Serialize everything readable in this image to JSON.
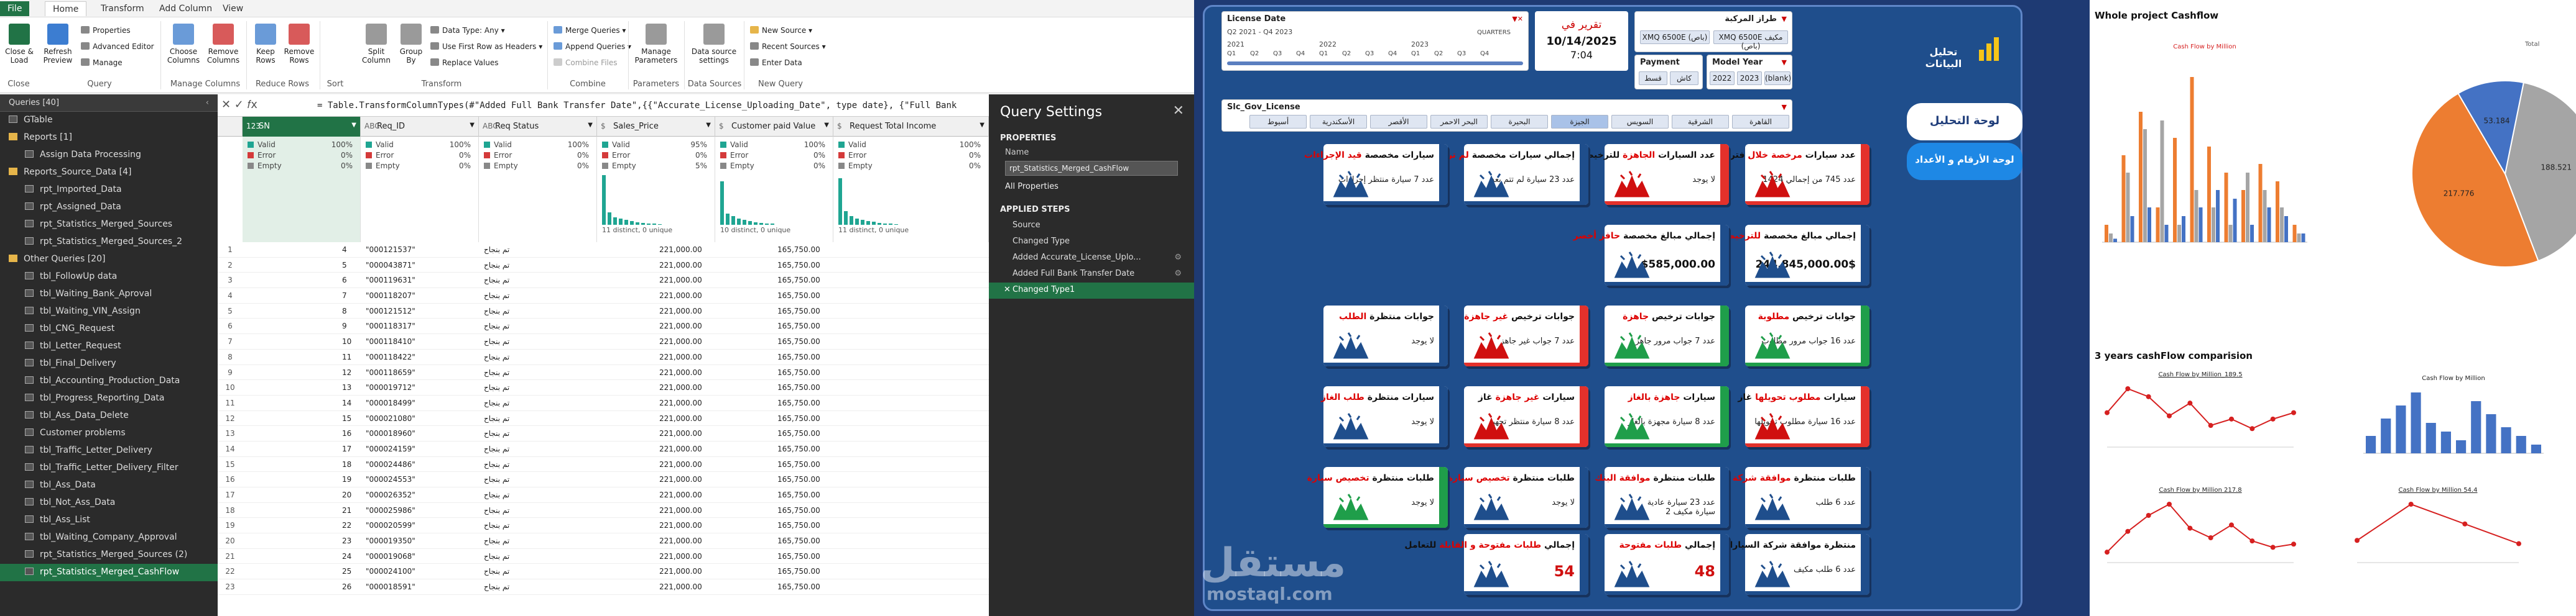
{
  "pq": {
    "tabs": [
      "File",
      "Home",
      "Transform",
      "Add Column",
      "View"
    ],
    "ribbon": {
      "close_load": "Close &\nLoad",
      "refresh": "Refresh\nPreview",
      "properties": "Properties",
      "advanced_editor": "Advanced Editor",
      "manage": "Manage",
      "choose_columns": "Choose\nColumns",
      "remove_columns": "Remove\nColumns",
      "keep_rows": "Keep\nRows",
      "remove_rows": "Remove\nRows",
      "split_column": "Split\nColumn",
      "group_by": "Group\nBy",
      "data_type": "Data Type: Any",
      "use_first_row": "Use First Row as Headers",
      "replace_values": "Replace Values",
      "merge_queries": "Merge Queries",
      "append_queries": "Append Queries",
      "combine_files": "Combine Files",
      "manage_parameters": "Manage\nParameters",
      "data_source_settings": "Data source\nsettings",
      "new_source": "New Source",
      "recent_sources": "Recent Sources",
      "enter_data": "Enter Data",
      "groups": [
        "Close",
        "Query",
        "Manage Columns",
        "Reduce Rows",
        "Sort",
        "Transform",
        "Combine",
        "Parameters",
        "Data Sources",
        "New Query"
      ]
    },
    "queries_header": "Queries [40]",
    "queries": [
      {
        "label": "GTable",
        "kind": "table",
        "indent": 0
      },
      {
        "label": "Reports [1]",
        "kind": "folder",
        "indent": 0
      },
      {
        "label": "Assign Data Processing",
        "kind": "table",
        "indent": 1
      },
      {
        "label": "Reports_Source_Data [4]",
        "kind": "folder",
        "indent": 0
      },
      {
        "label": "rpt_Imported_Data",
        "kind": "table",
        "indent": 1
      },
      {
        "label": "rpt_Assigned_Data",
        "kind": "table",
        "indent": 1
      },
      {
        "label": "rpt_Statistics_Merged_Sources",
        "kind": "table",
        "indent": 1
      },
      {
        "label": "rpt_Statistics_Merged_Sources_2",
        "kind": "table",
        "indent": 1
      },
      {
        "label": "Other Queries [20]",
        "kind": "folder",
        "indent": 0
      },
      {
        "label": "tbl_FollowUp data",
        "kind": "table",
        "indent": 1
      },
      {
        "label": "tbl_Waiting_Bank_Aproval",
        "kind": "table",
        "indent": 1
      },
      {
        "label": "tbl_Waiting_VIN_Assign",
        "kind": "table",
        "indent": 1
      },
      {
        "label": "tbl_CNG_Request",
        "kind": "table",
        "indent": 1
      },
      {
        "label": "tbl_Letter_Request",
        "kind": "table",
        "indent": 1
      },
      {
        "label": "tbl_Final_Delivery",
        "kind": "table",
        "indent": 1
      },
      {
        "label": "tbl_Accounting_Production_Data",
        "kind": "table",
        "indent": 1
      },
      {
        "label": "tbl_Progress_Reporting_Data",
        "kind": "table",
        "indent": 1
      },
      {
        "label": "tbl_Ass_Data_Delete",
        "kind": "table",
        "indent": 1
      },
      {
        "label": "Customer problems",
        "kind": "table",
        "indent": 1
      },
      {
        "label": "tbl_Traffic_Letter_Delivery",
        "kind": "table",
        "indent": 1
      },
      {
        "label": "tbl_Traffic_Letter_Delivery_Filter",
        "kind": "table",
        "indent": 1
      },
      {
        "label": "tbl_Ass_Data",
        "kind": "table",
        "indent": 1
      },
      {
        "label": "tbl_Not_Ass_Data",
        "kind": "table",
        "indent": 1
      },
      {
        "label": "tbl_Ass_List",
        "kind": "table",
        "indent": 1
      },
      {
        "label": "tbl_Waiting_Company_Approval",
        "kind": "table",
        "indent": 1
      },
      {
        "label": "rpt_Statistics_Merged_Sources (2)",
        "kind": "table",
        "indent": 1
      },
      {
        "label": "rpt_Statistics_Merged_CashFlow",
        "kind": "table",
        "indent": 1,
        "selected": true
      }
    ],
    "formula": "= Table.TransformColumnTypes(#\"Added Full Bank Transfer Date\",{{\"Accurate_License_Uploading_Date\", type date}, {\"Full Bank",
    "columns": [
      {
        "label": "SN",
        "type": "123",
        "sel": true
      },
      {
        "label": "Req_ID",
        "type": "ABC"
      },
      {
        "label": "Req Status",
        "type": "ABC"
      },
      {
        "label": "Sales_Price",
        "type": "$"
      },
      {
        "label": "Customer paid Value",
        "type": "$"
      },
      {
        "label": "Request Total Income",
        "type": "$"
      }
    ],
    "profile": [
      {
        "valid": "100%",
        "error": "0%",
        "empty": "0%",
        "dist": ""
      },
      {
        "valid": "100%",
        "error": "0%",
        "empty": "0%",
        "dist": ""
      },
      {
        "valid": "100%",
        "error": "0%",
        "empty": "0%",
        "dist": ""
      },
      {
        "valid": "95%",
        "error": "0%",
        "empty": "5%",
        "dist": "11 distinct, 0 unique"
      },
      {
        "valid": "100%",
        "error": "0%",
        "empty": "0%",
        "dist": "10 distinct, 0 unique"
      },
      {
        "valid": "100%",
        "error": "0%",
        "empty": "0%",
        "dist": "11 distinct, 0 unique"
      }
    ],
    "profile_labels": {
      "valid": "Valid",
      "error": "Error",
      "empty": "Empty"
    },
    "rows": [
      {
        "n": "1",
        "sn": "4",
        "id": "\"000121537\"",
        "st": "تم بنجاح",
        "sp": "221,000.00",
        "cp": "165,750.00"
      },
      {
        "n": "2",
        "sn": "5",
        "id": "\"000043871\"",
        "st": "تم بنجاح",
        "sp": "221,000.00",
        "cp": "165,750.00"
      },
      {
        "n": "3",
        "sn": "6",
        "id": "\"000119631\"",
        "st": "تم بنجاح",
        "sp": "221,000.00",
        "cp": "165,750.00"
      },
      {
        "n": "4",
        "sn": "7",
        "id": "\"000118207\"",
        "st": "تم بنجاح",
        "sp": "221,000.00",
        "cp": "165,750.00"
      },
      {
        "n": "5",
        "sn": "8",
        "id": "\"000121512\"",
        "st": "تم بنجاح",
        "sp": "221,000.00",
        "cp": "165,750.00"
      },
      {
        "n": "6",
        "sn": "9",
        "id": "\"000118317\"",
        "st": "تم بنجاح",
        "sp": "221,000.00",
        "cp": "165,750.00"
      },
      {
        "n": "7",
        "sn": "10",
        "id": "\"000118410\"",
        "st": "تم بنجاح",
        "sp": "221,000.00",
        "cp": "165,750.00"
      },
      {
        "n": "8",
        "sn": "11",
        "id": "\"000118422\"",
        "st": "تم بنجاح",
        "sp": "221,000.00",
        "cp": "165,750.00"
      },
      {
        "n": "9",
        "sn": "12",
        "id": "\"000118659\"",
        "st": "تم بنجاح",
        "sp": "221,000.00",
        "cp": "165,750.00"
      },
      {
        "n": "10",
        "sn": "13",
        "id": "\"000019712\"",
        "st": "تم بنجاح",
        "sp": "221,000.00",
        "cp": "165,750.00"
      },
      {
        "n": "11",
        "sn": "14",
        "id": "\"000018499\"",
        "st": "تم بنجاح",
        "sp": "221,000.00",
        "cp": "165,750.00"
      },
      {
        "n": "12",
        "sn": "15",
        "id": "\"000021080\"",
        "st": "تم بنجاح",
        "sp": "221,000.00",
        "cp": "165,750.00"
      },
      {
        "n": "13",
        "sn": "16",
        "id": "\"000018960\"",
        "st": "تم بنجاح",
        "sp": "221,000.00",
        "cp": "165,750.00"
      },
      {
        "n": "14",
        "sn": "17",
        "id": "\"000024159\"",
        "st": "تم بنجاح",
        "sp": "221,000.00",
        "cp": "165,750.00"
      },
      {
        "n": "15",
        "sn": "18",
        "id": "\"000024486\"",
        "st": "تم بنجاح",
        "sp": "221,000.00",
        "cp": "165,750.00"
      },
      {
        "n": "16",
        "sn": "19",
        "id": "\"000024553\"",
        "st": "تم بنجاح",
        "sp": "221,000.00",
        "cp": "165,750.00"
      },
      {
        "n": "17",
        "sn": "20",
        "id": "\"000026352\"",
        "st": "تم بنجاح",
        "sp": "221,000.00",
        "cp": "165,750.00"
      },
      {
        "n": "18",
        "sn": "21",
        "id": "\"000025986\"",
        "st": "تم بنجاح",
        "sp": "221,000.00",
        "cp": "165,750.00"
      },
      {
        "n": "19",
        "sn": "22",
        "id": "\"000020599\"",
        "st": "تم بنجاح",
        "sp": "221,000.00",
        "cp": "165,750.00"
      },
      {
        "n": "20",
        "sn": "23",
        "id": "\"000019350\"",
        "st": "تم بنجاح",
        "sp": "221,000.00",
        "cp": "165,750.00"
      },
      {
        "n": "21",
        "sn": "24",
        "id": "\"000019068\"",
        "st": "تم بنجاح",
        "sp": "221,000.00",
        "cp": "165,750.00"
      },
      {
        "n": "22",
        "sn": "25",
        "id": "\"000024100\"",
        "st": "تم بنجاح",
        "sp": "221,000.00",
        "cp": "165,750.00"
      },
      {
        "n": "23",
        "sn": "26",
        "id": "\"000018591\"",
        "st": "تم بنجاح",
        "sp": "221,000.00",
        "cp": "165,750.00"
      }
    ],
    "settings": {
      "title": "Query Settings",
      "properties": "PROPERTIES",
      "name_label": "Name",
      "name_value": "rpt_Statistics_Merged_CashFlow",
      "all_props": "All Properties",
      "applied": "APPLIED STEPS",
      "steps": [
        "Source",
        "Changed Type",
        "Added Accurate_License_Uplo...",
        "Added Full Bank Transfer Date",
        "Changed Type1"
      ]
    }
  },
  "dash": {
    "license_date": {
      "title": "License Date",
      "range": "Q2 2021 - Q4 2023",
      "period": "QUARTERS",
      "years": [
        "2021",
        "2022",
        "2023"
      ],
      "quarters": [
        "Q1",
        "Q2",
        "Q3",
        "Q4",
        "Q1",
        "Q2",
        "Q3",
        "Q4",
        "Q1",
        "Q2",
        "Q3",
        "Q4"
      ]
    },
    "report_date": {
      "label": "تقرير في",
      "date": "10/14/2025",
      "time": "7:04"
    },
    "model": {
      "title": "طراز المركبة",
      "options": [
        "XMQ 6500E (باص)",
        "XMQ 6500E مكيف (باص)"
      ]
    },
    "payment": {
      "title": "Payment",
      "options": [
        "قسط",
        "كاش"
      ]
    },
    "model_year": {
      "title": "Model Year",
      "options": [
        "2022",
        "2023",
        "(blank)"
      ]
    },
    "gov": {
      "title": "Slc_Gov_License",
      "options": [
        "القاهرة",
        "الشرقية",
        "السويس",
        "الجيزة",
        "البحيرة",
        "البحر الاحمر",
        "الأقصر",
        "الأسكندرية",
        "أسيوط"
      ]
    },
    "logo_text": "تحليل البيانات",
    "btn_analysis": "لوحة التحليل",
    "btn_numbers": "لوحة الأرقام و الأعداد",
    "watermark1": "مستقل",
    "watermark2": "mostaql.com",
    "cards": [
      {
        "t1": "عدد سيارات ",
        "t2": "مرخصة خلال",
        "t3": " فترة",
        "sub": "عدد 745 من إجمالي 1424",
        "side": "#e4312b"
      },
      {
        "t1": "عدد السيارات ",
        "t2": "الجاهزة",
        "t3": " للترخيص",
        "sub": "لا يوجد",
        "side": "#e4312b"
      },
      {
        "t1": "إجمالي سيارات مخصصة ",
        "t2": "لم ترخص",
        "t3": "",
        "sub": "عدد 23 سيارة لم تتم بعد",
        "side": "#1f4e8c"
      },
      {
        "t1": "سيارات مخصصة ",
        "t2": "قيد الإجراءات",
        "t3": "",
        "sub": "عدد 7 سيارة منتظر إجراءات",
        "side": "#1f4e8c"
      },
      {
        "t1": "إجمالي مبالغ مخصصة ",
        "t2": "للترخيص خلال الفترة",
        "t3": "",
        "big": "244,845,000.00$",
        "side": "#1f4e8c"
      },
      {
        "t1": "إجمالي مبالغ مخصصة ",
        "t2": "حافز أخضر",
        "t3": "",
        "big": "$585,000.00",
        "side": "#1f4e8c"
      },
      {
        "t1": "جوابات ترخيص ",
        "t2": "مطلوبة",
        "t3": "",
        "sub": "عدد 16 جواب مرور مطلوب",
        "side": "#1f9e4a"
      },
      {
        "t1": "جوابات ترخيص ",
        "t2": "جاهزة",
        "t3": "",
        "sub": "عدد 7 جواب مرور جاهز",
        "side": "#1f9e4a"
      },
      {
        "t1": "جوابات ترخيص ",
        "t2": "غير جاهزة",
        "t3": "",
        "sub": "عدد 7 جواب غير جاهز",
        "side": "#e4312b"
      },
      {
        "t1": "جوابات منتظرة ",
        "t2": "الطلب",
        "t3": "",
        "sub": "لا يوجد",
        "side": "#1f4e8c"
      },
      {
        "t1": "سيارات ",
        "t2": "مطلوب تحويلها",
        "t3": " غاز",
        "sub": "عدد 16 سيارة مطلوب تحويلها",
        "side": "#e4312b"
      },
      {
        "t1": "سيارات ",
        "t2": "جاهزة بالغاز",
        "t3": "",
        "sub": "عدد 8 سيارة مجهزة بالغاز",
        "side": "#1f9e4a"
      },
      {
        "t1": "سيارات ",
        "t2": "غير جاهزة",
        "t3": " غاز",
        "sub": "عدد 8 سيارة منتظر تجهيز",
        "side": "#e4312b"
      },
      {
        "t1": "سيارات منتظرة ",
        "t2": "طلب الغاز",
        "t3": "",
        "sub": "لا يوجد",
        "side": "#1f4e8c"
      },
      {
        "t1": "طلبات منتظرة ",
        "t2": "موافقة شركة السيارات",
        "t3": "",
        "sub": "عدد 6 طلب",
        "side": "#1f4e8c"
      },
      {
        "t1": "طلبات منتظرة ",
        "t2": "موافقة البنك",
        "t3": "",
        "sub": "عدد 23 سيارة عادية\n2 سيارة مكيف",
        "side": "#1f4e8c"
      },
      {
        "t1": "طلبات منتظرة ",
        "t2": "تخصيص سيارة",
        "t3": "",
        "sub": "لا يوجد",
        "side": "#1f4e8c"
      },
      {
        "t1": "طلبات منتظرة ",
        "t2": "تخصيص سيارة",
        "t3": "",
        "sub": "لا يوجد",
        "side": "#1f9e4a"
      },
      {
        "t1": "منتظرة موافقة شركة السيارات ",
        "t2": "",
        "t3": "بالنوع",
        "sub": "عدد 6 طلب مكيف",
        "side": "#1f4e8c"
      },
      {
        "t1": "إجمالي ",
        "t2": "طلبات مفتوحة",
        "t3": "",
        "big": "48",
        "side": "#1f4e8c"
      },
      {
        "t1": "إجمالي ",
        "t2": "طلبات مفتوحة و القابلة",
        "t3": " للتعامل",
        "big": "54",
        "side": "#1f4e8c"
      }
    ]
  },
  "sheet": {
    "title1": "Whole project Cashflow",
    "title2": "3 years cashFlow comparision",
    "chart_data": [
      {
        "type": "bar",
        "title": "Cash Flow by Million",
        "series": [
          {
            "name": "",
            "values": [
              10,
              50,
              75,
              20,
              60,
              95,
              55,
              40,
              30,
              45,
              35,
              10
            ],
            "color": "#ed7d31"
          },
          {
            "name": "",
            "values": [
              5,
              40,
              65,
              70,
              10,
              30,
              20,
              10,
              40,
              30,
              20,
              5
            ],
            "color": "#a5a5a5"
          },
          {
            "name": "",
            "values": [
              2,
              15,
              20,
              10,
              15,
              20,
              30,
              25,
              10,
              20,
              15,
              5
            ],
            "color": "#4472c4"
          }
        ],
        "categories": [
          "",
          "",
          "",
          "",
          "",
          "",
          "",
          "",
          "",
          "",
          "",
          ""
        ]
      },
      {
        "type": "pie",
        "title": "Total",
        "values": [
          188.521,
          217.776,
          53.184
        ],
        "colors": [
          "#a5a5a5",
          "#ed7d31",
          "#4472c4"
        ],
        "labels": [
          "188.521",
          "217.776",
          "53.184"
        ]
      },
      {
        "type": "line",
        "title": "Cash Flow by Million_189.5",
        "values": [
          20,
          35,
          30,
          18,
          26,
          12,
          16,
          10,
          16,
          20
        ]
      },
      {
        "type": "bar",
        "title": "Cash Flow by Million",
        "values": [
          20,
          40,
          55,
          70,
          35,
          25,
          15,
          60,
          45,
          30,
          20,
          10
        ],
        "color": "#4472c4"
      },
      {
        "type": "line",
        "title": "Cash Flow by Million 217.8",
        "values": [
          5,
          18,
          28,
          35,
          20,
          14,
          22,
          12,
          8,
          10
        ]
      },
      {
        "type": "line",
        "title": "Cash Flow by Million 54.4",
        "values": [
          12,
          34,
          22,
          10
        ]
      }
    ]
  }
}
